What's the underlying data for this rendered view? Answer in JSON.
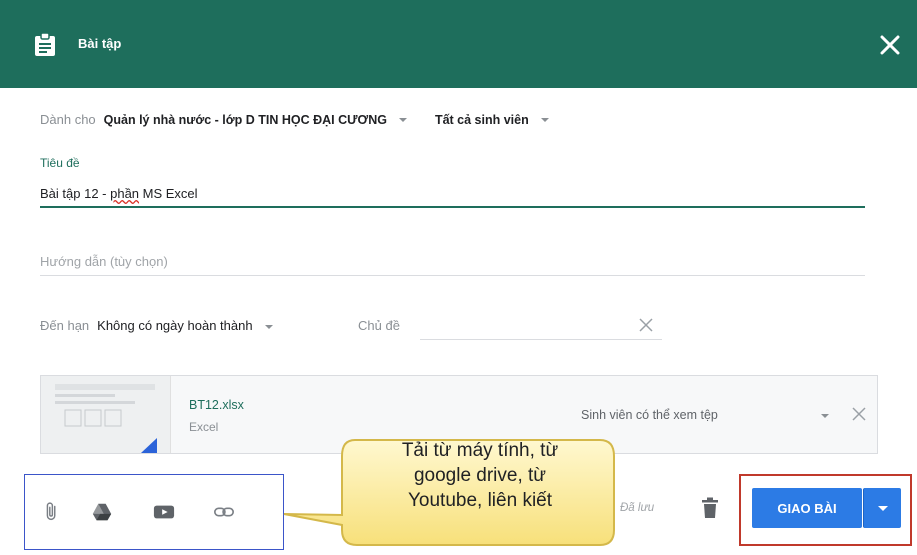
{
  "header": {
    "title": "Bài tập",
    "icon": "assignment-icon",
    "close_icon": "close-icon",
    "color": "#1e6e5c"
  },
  "assign": {
    "for_label": "Dành cho",
    "class_value": "Quản lý nhà nước - lớp D TIN HỌC ĐẠI CƯƠNG",
    "students_value": "Tất cả sinh viên"
  },
  "title_field": {
    "label": "Tiêu đề",
    "value_prefix": "Bài tập 12 - ",
    "value_word": "phần",
    "value_suffix": " MS Excel"
  },
  "instructions": {
    "placeholder": "Hướng dẫn (tùy chọn)"
  },
  "due": {
    "label": "Đến hạn",
    "value": "Không có ngày hoàn thành"
  },
  "topic": {
    "label": "Chủ đề"
  },
  "attachment": {
    "file_name": "BT12.xlsx",
    "file_type": "Excel",
    "permission": "Sinh viên có thể xem tệp"
  },
  "tools": [
    "attach-icon",
    "google-drive-icon",
    "youtube-icon",
    "link-icon"
  ],
  "callout": {
    "line1": "Tải từ máy tính, từ",
    "line2": "google drive, từ",
    "line3": "Youtube, liên kiết"
  },
  "footer": {
    "saved_text": "Đã lưu",
    "submit_label": "GIAO BÀI"
  },
  "colors": {
    "accent": "#1e6e5c",
    "button": "#2c7be5",
    "highlight_box": "#3b55c9",
    "frame_red": "#c0392b",
    "callout_fill": "#fdf1a8"
  }
}
